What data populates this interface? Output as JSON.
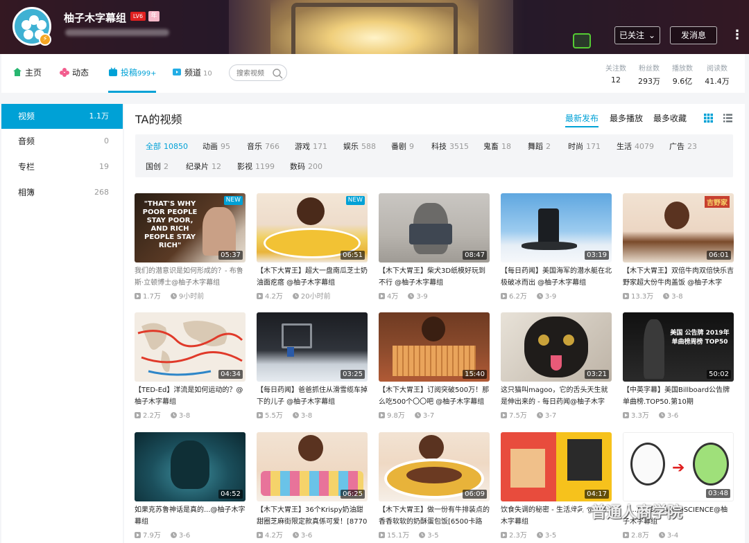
{
  "header": {
    "username": "柚子木字幕组",
    "level_badge": "LV6",
    "vip_badge": "年",
    "follow_label": "已关注",
    "message_label": "发消息",
    "more_label": "⋮"
  },
  "nav": {
    "home": "主页",
    "dynamic": "动态",
    "contribute": "投稿",
    "contribute_count": "999+",
    "channel": "频道",
    "channel_count": "10",
    "search_placeholder": "搜索视频"
  },
  "stats": [
    {
      "label": "关注数",
      "value": "12"
    },
    {
      "label": "粉丝数",
      "value": "293万"
    },
    {
      "label": "播放数",
      "value": "9.6亿"
    },
    {
      "label": "阅读数",
      "value": "41.4万"
    }
  ],
  "sidebar": [
    {
      "label": "视频",
      "count": "1.1万"
    },
    {
      "label": "音频",
      "count": "0"
    },
    {
      "label": "专栏",
      "count": "19"
    },
    {
      "label": "相簿",
      "count": "268"
    }
  ],
  "main": {
    "title": "TA的视频",
    "sort_latest": "最新发布",
    "sort_play": "最多播放",
    "sort_fav": "最多收藏"
  },
  "filters": [
    {
      "label": "全部",
      "count": "10850"
    },
    {
      "label": "动画",
      "count": "95"
    },
    {
      "label": "音乐",
      "count": "766"
    },
    {
      "label": "游戏",
      "count": "171"
    },
    {
      "label": "娱乐",
      "count": "588"
    },
    {
      "label": "番剧",
      "count": "9"
    },
    {
      "label": "科技",
      "count": "3515"
    },
    {
      "label": "鬼畜",
      "count": "18"
    },
    {
      "label": "舞蹈",
      "count": "2"
    },
    {
      "label": "时尚",
      "count": "171"
    },
    {
      "label": "生活",
      "count": "4079"
    },
    {
      "label": "广告",
      "count": "23"
    },
    {
      "label": "国创",
      "count": "2"
    },
    {
      "label": "纪录片",
      "count": "12"
    },
    {
      "label": "影视",
      "count": "1199"
    },
    {
      "label": "数码",
      "count": "200"
    }
  ],
  "videos": [
    {
      "title": "我们的潜意识是如何形成的？- 布鲁斯·立顿博士@柚子木字幕组",
      "duration": "05:37",
      "plays": "1.7万",
      "time": "9小时前",
      "new": "NEW",
      "thumb_text": "\"THAT'S WHY POOR PEOPLE STAY POOR, AND RICH PEOPLE STAY RICH\""
    },
    {
      "title": "【木下大胃王】超大一盘南瓜芝士奶油面疙瘩 @柚子木字幕组",
      "duration": "06:51",
      "plays": "4.2万",
      "time": "20小时前",
      "new": "NEW"
    },
    {
      "title": "【木下大胃王】柴犬3D纸模好玩到不行 @柚子木字幕组",
      "duration": "08:47",
      "plays": "4万",
      "time": "3-9"
    },
    {
      "title": "【每日药闻】美国海军的潜水艇在北极破冰而出 @柚子木字幕组",
      "duration": "03:19",
      "plays": "6.2万",
      "time": "3-9"
    },
    {
      "title": "【木下大胃王】双倍牛肉双倍快乐吉野家超大份牛肉盖饭 @柚子木字",
      "duration": "06:01",
      "plays": "13.3万",
      "time": "3-8",
      "thumb_text": "吉野家"
    },
    {
      "title": "【TED-Ed】洋流是如何运动的？@柚子木字幕组",
      "duration": "04:34",
      "plays": "2.2万",
      "time": "3-8"
    },
    {
      "title": "【每日药闻】爸爸抓住从滑雪缆车掉下的儿子 @柚子木字幕组",
      "duration": "03:25",
      "plays": "5.5万",
      "time": "3-8"
    },
    {
      "title": "【木下大胃王】订阅突破500万！那么吃500个〇〇吧 @柚子木字幕组",
      "duration": "15:40",
      "plays": "9.8万",
      "time": "3-7"
    },
    {
      "title": "这只猫叫magoo，它的舌头天生就是伸出来的 - 每日药闻@柚子木字",
      "duration": "03:21",
      "plays": "7.5万",
      "time": "3-7"
    },
    {
      "title": "【中英字幕】美国Billboard公告牌单曲榜.TOP50.第10期",
      "duration": "50:02",
      "plays": "3.3万",
      "time": "3-6",
      "thumb_text": "美国 公告牌 2019年单曲榜周榜 TOP50"
    },
    {
      "title": "如果克苏鲁神话是真的...@柚子木字幕组",
      "duration": "04:52",
      "plays": "7.9万",
      "time": "3-6"
    },
    {
      "title": "【木下大胃王】36个Krispy奶油甜甜圈芝麻街限定款真係可爱！[8770",
      "duration": "06:25",
      "plays": "4.2万",
      "time": "3-6"
    },
    {
      "title": "【木下大胃王】做一份有牛排装点的香香软软的奶酥蛋包饭[6500卡路",
      "duration": "06:09",
      "plays": "15.1万",
      "time": "3-5"
    },
    {
      "title": "饮食失调的秘密 - 生活辞典 @柚子木字幕组",
      "duration": "04:17",
      "plays": "2.3万",
      "time": "3-5"
    },
    {
      "title": "【…】…的… AsapSCIENCE@柚子木字幕组",
      "duration": "03:48",
      "plays": "2.8万",
      "time": "3-4"
    }
  ],
  "watermark": "普通人商学院"
}
